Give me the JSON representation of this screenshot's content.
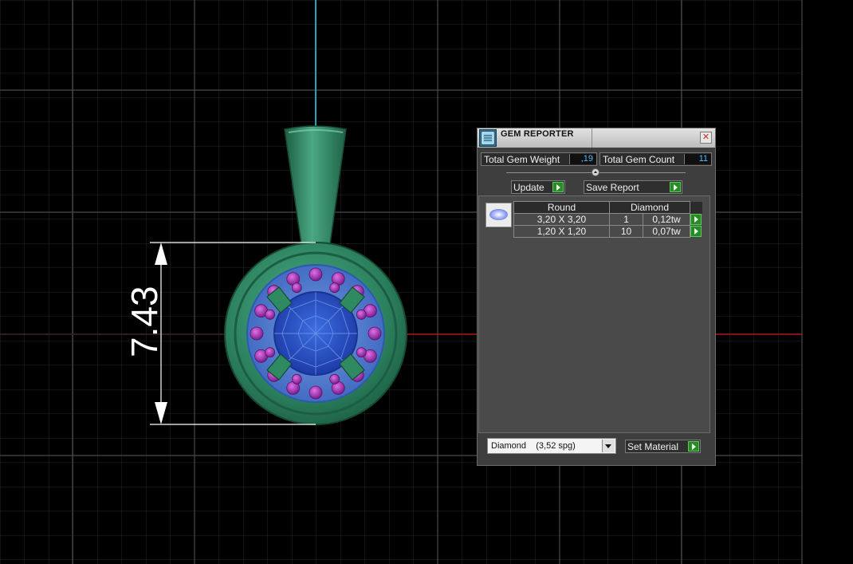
{
  "viewport": {
    "dimension_label": "7.43"
  },
  "gem_reporter": {
    "title": "GEM REPORTER",
    "close_glyph": "✕",
    "total_gem_weight_label": "Total Gem Weight",
    "total_gem_weight_value": ",19",
    "total_gem_count_label": "Total Gem Count",
    "total_gem_count_value": "11",
    "update_label": "Update",
    "save_report_label": "Save Report",
    "table": {
      "headers": [
        "Round",
        "Diamond"
      ],
      "rows": [
        {
          "size": "3,20 X 3,20",
          "count": "1",
          "weight": "0,12tw"
        },
        {
          "size": "1,20 X 1,20",
          "count": "10",
          "weight": "0,07tw"
        }
      ]
    },
    "material_select_value": "Diamond    (3,52 spg)",
    "set_material_label": "Set Material"
  },
  "colors": {
    "metal": "#2f8a62",
    "center_stone": "#2f55c8",
    "side_stones": "#9a2fa8",
    "grid": "#3a3a3a",
    "axis_red": "#b01818",
    "axis_cyan": "#2aa0b8",
    "accent_green": "#2a8a2a"
  }
}
